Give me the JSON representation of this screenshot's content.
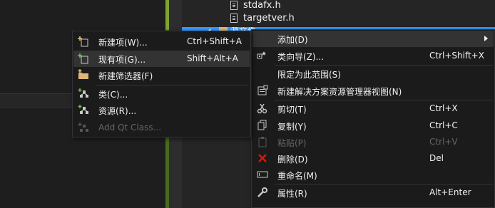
{
  "tree": {
    "items": [
      {
        "label": "stdafx.h"
      },
      {
        "label": "targetver.h"
      }
    ],
    "selected_label": "源文件"
  },
  "context_menu": {
    "items": [
      {
        "label": "添加(D)",
        "shortcut": "",
        "icon": "none",
        "has_submenu": true,
        "highlighted": true
      },
      {
        "label": "类向导(Z)...",
        "shortcut": "Ctrl+Shift+X",
        "icon": "class-wizard-icon"
      },
      {
        "label": "限定为此范围(S)",
        "shortcut": "",
        "icon": "none"
      },
      {
        "label": "新建解决方案资源管理器视图(N)",
        "shortcut": "",
        "icon": "new-view-icon"
      },
      {
        "label": "剪切(T)",
        "shortcut": "Ctrl+X",
        "icon": "scissors-icon"
      },
      {
        "label": "复制(Y)",
        "shortcut": "Ctrl+C",
        "icon": "copy-icon"
      },
      {
        "label": "粘贴(P)",
        "shortcut": "Ctrl+V",
        "icon": "paste-icon",
        "disabled": true
      },
      {
        "label": "删除(D)",
        "shortcut": "Del",
        "icon": "delete-x-icon"
      },
      {
        "label": "重命名(M)",
        "shortcut": "",
        "icon": "rename-icon"
      },
      {
        "label": "属性(R)",
        "shortcut": "Alt+Enter",
        "icon": "wrench-icon"
      }
    ]
  },
  "add_submenu": {
    "items": [
      {
        "label": "新建项(W)...",
        "shortcut": "Ctrl+Shift+A",
        "icon": "new-item-icon"
      },
      {
        "label": "现有项(G)...",
        "shortcut": "Shift+Alt+A",
        "icon": "existing-item-icon",
        "highlighted": true
      },
      {
        "label": "新建筛选器(F)",
        "shortcut": "",
        "icon": "new-filter-folder-icon"
      },
      {
        "label": "类(C)...",
        "shortcut": "",
        "icon": "class-icon"
      },
      {
        "label": "资源(R)...",
        "shortcut": "",
        "icon": "resource-icon"
      },
      {
        "label": "Add Qt Class...",
        "shortcut": "",
        "icon": "qt-class-icon",
        "disabled": true
      }
    ]
  },
  "colors": {
    "menu_bg": "#1b1b1c",
    "hover_bg": "#333334",
    "selection_blue": "#3399ff",
    "delete_red": "#e51400",
    "disabled_text": "#656565"
  }
}
